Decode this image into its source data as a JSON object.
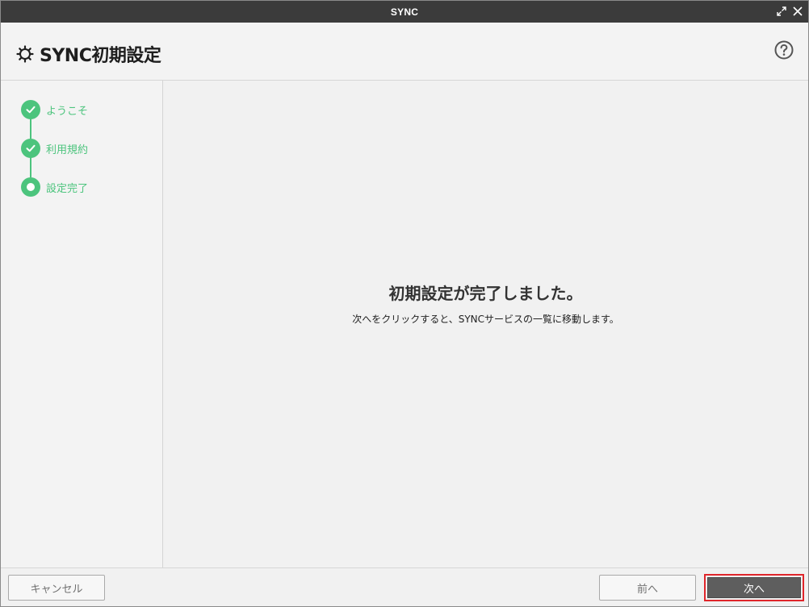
{
  "titlebar": {
    "title": "SYNC",
    "icons": [
      "expand-icon",
      "close-icon"
    ]
  },
  "header": {
    "title": "SYNC初期設定",
    "icon": "gear-icon",
    "help_icon": "help-circle-icon"
  },
  "steps": [
    {
      "label": "ようこそ",
      "state": "completed",
      "icon": "check-icon"
    },
    {
      "label": "利用規約",
      "state": "completed",
      "icon": "check-icon"
    },
    {
      "label": "設定完了",
      "state": "current",
      "icon": "dot-icon"
    }
  ],
  "main": {
    "heading": "初期設定が完了しました。",
    "message": "次へをクリックすると、SYNCサービスの一覧に移動します。"
  },
  "footer": {
    "cancel_label": "キャンセル",
    "prev_label": "前へ",
    "next_label": "次へ"
  },
  "colors": {
    "accent": "#4cc47d",
    "titlebar": "#3b3b3b",
    "primary_button": "#5e5e5e",
    "focus_outline": "#e0262b"
  }
}
